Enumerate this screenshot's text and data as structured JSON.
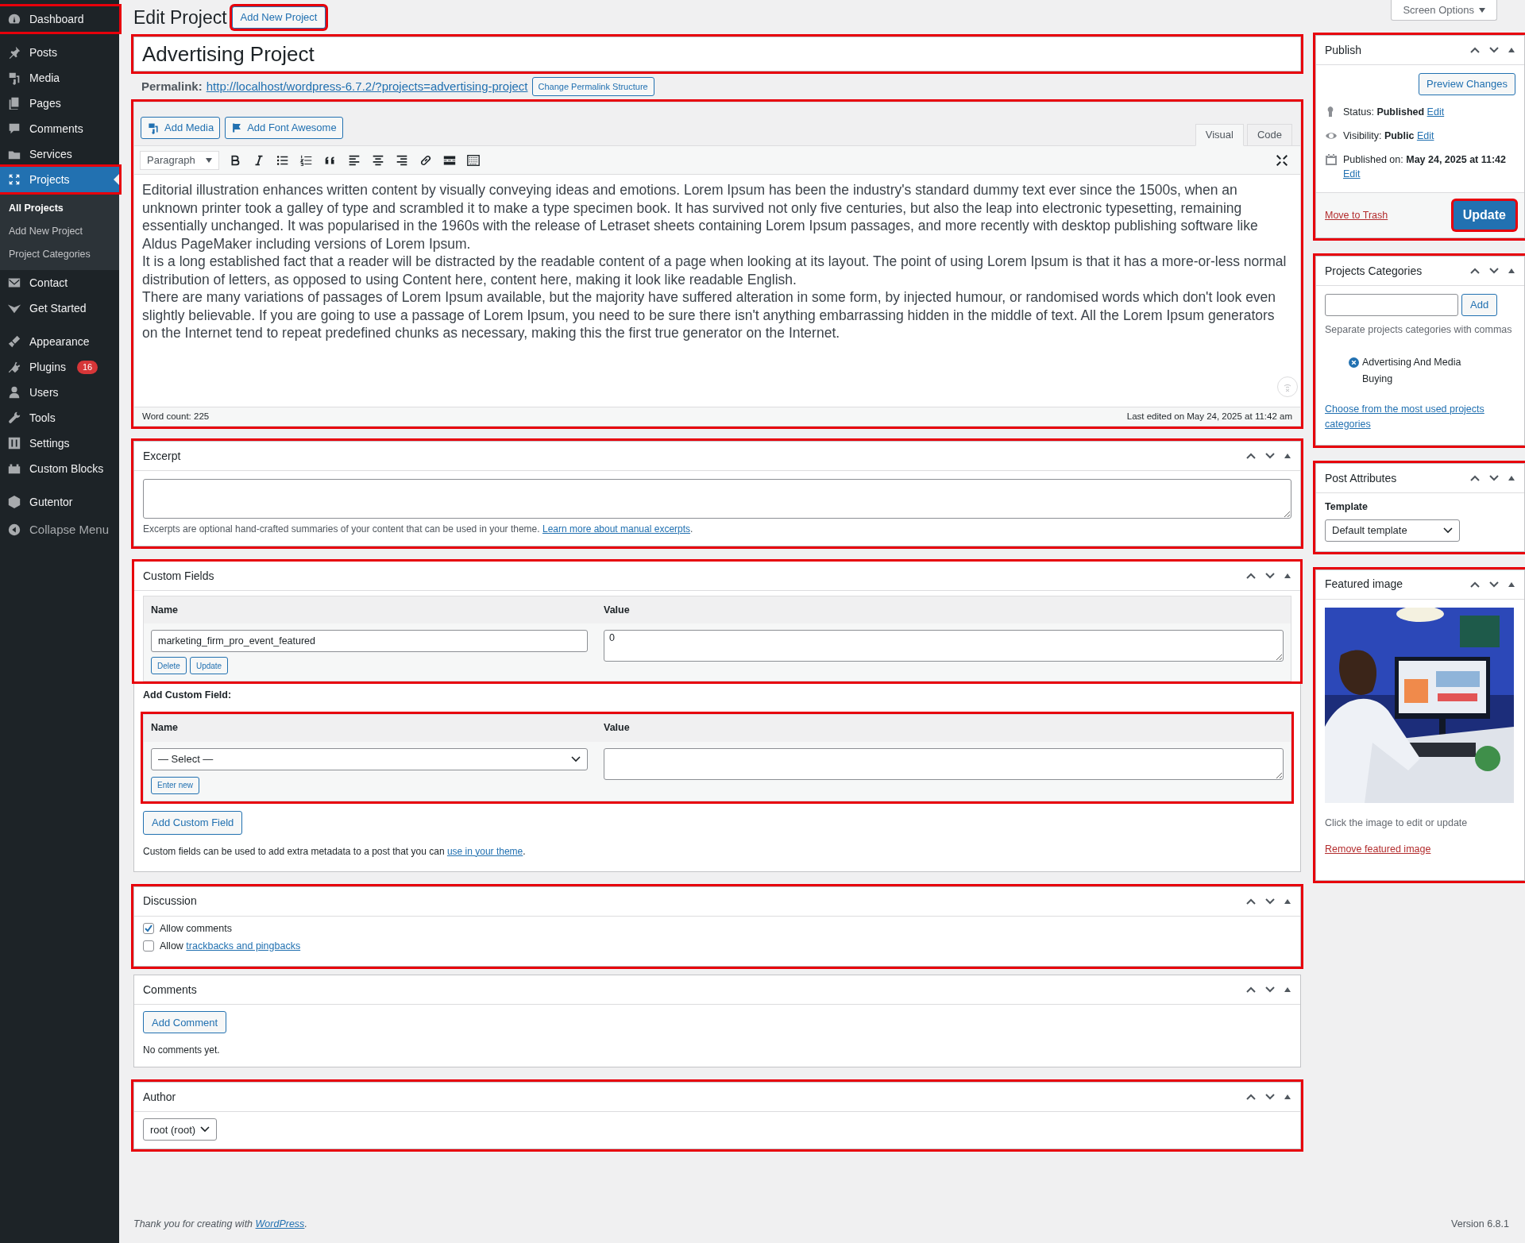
{
  "sidebar": {
    "items": [
      {
        "label": "Dashboard",
        "selected": false,
        "highlighted": true
      },
      {
        "label": "Posts",
        "selected": false,
        "highlighted": false
      },
      {
        "label": "Media",
        "selected": false,
        "highlighted": false
      },
      {
        "label": "Pages",
        "selected": false,
        "highlighted": false
      },
      {
        "label": "Comments",
        "selected": false,
        "highlighted": false
      },
      {
        "label": "Services",
        "selected": false,
        "highlighted": false
      },
      {
        "label": "Projects",
        "selected": true,
        "highlighted": true,
        "children": [
          {
            "label": "All Projects",
            "selected": true
          },
          {
            "label": "Add New Project",
            "selected": false
          },
          {
            "label": "Project Categories",
            "selected": false
          }
        ]
      },
      {
        "label": "Contact",
        "selected": false,
        "highlighted": false
      },
      {
        "label": "Get Started",
        "selected": false,
        "highlighted": false
      },
      {
        "label": "Appearance",
        "selected": false,
        "highlighted": false
      },
      {
        "label": "Plugins",
        "selected": false,
        "highlighted": false,
        "badge": "16"
      },
      {
        "label": "Users",
        "selected": false,
        "highlighted": false
      },
      {
        "label": "Tools",
        "selected": false,
        "highlighted": false
      },
      {
        "label": "Settings",
        "selected": false,
        "highlighted": false
      },
      {
        "label": "Custom Blocks",
        "selected": false,
        "highlighted": false
      },
      {
        "label": "Gutentor",
        "selected": false,
        "highlighted": false
      }
    ],
    "collapse": "Collapse Menu"
  },
  "header": {
    "title": "Edit Project",
    "add_new": {
      "label": "Add New Project",
      "highlighted": true
    },
    "screen_options": "Screen Options"
  },
  "post_title": {
    "value": "Advertising Project",
    "highlighted": true
  },
  "permalink": {
    "label": "Permalink:",
    "url": "http://localhost/wordpress-6.7.2/?projects=advertising-project",
    "button": "Change Permalink Structure"
  },
  "editor": {
    "highlighted": true,
    "media_buttons": [
      "Add Media",
      "Add Font Awesome"
    ],
    "tabs": [
      {
        "label": "Visual",
        "selected": true
      },
      {
        "label": "Code",
        "selected": false
      }
    ],
    "format": "Paragraph",
    "paragraphs": [
      "Editorial illustration enhances written content by visually conveying ideas and emotions. Lorem Ipsum has been the industry's standard dummy text ever since the 1500s, when an unknown printer took a galley of type and scrambled it to make a type specimen book. It has survived not only five centuries, but also the leap into electronic typesetting, remaining essentially unchanged. It was popularised in the 1960s with the release of Letraset sheets containing Lorem Ipsum passages, and more recently with desktop publishing software like Aldus PageMaker including versions of Lorem Ipsum.",
      "It is a long established fact that a reader will be distracted by the readable content of a page when looking at its layout. The point of using Lorem Ipsum is that it has a more-or-less normal distribution of letters, as opposed to using Content here, content here, making it look like readable English.",
      "There are many variations of passages of Lorem Ipsum available, but the majority have suffered alteration in some form, by injected humour, or randomised words which don't look even slightly believable. If you are going to use a passage of Lorem Ipsum, you need to be sure there isn't anything embarrassing hidden in the middle of text. All the Lorem Ipsum generators on the Internet tend to repeat predefined chunks as necessary, making this the first true generator on the Internet."
    ],
    "word_count": "Word count: 225",
    "last_edited": "Last edited on May 24, 2025 at 11:42 am"
  },
  "excerpt": {
    "title": "Excerpt",
    "highlighted": true,
    "help": "Excerpts are optional hand-crafted summaries of your content that can be used in your theme.",
    "help_link": "Learn more about manual excerpts",
    "help_end": "."
  },
  "custom_fields": {
    "title": "Custom Fields",
    "highlighted": true,
    "columns": [
      "Name",
      "Value"
    ],
    "rows": [
      {
        "name": "marketing_firm_pro_event_featured",
        "value": "0",
        "buttons": [
          "Delete",
          "Update"
        ]
      }
    ],
    "add_label": "Add Custom Field:",
    "add": {
      "highlighted": true,
      "columns": [
        "Name",
        "Value"
      ],
      "select": "— Select —",
      "enter_new": "Enter new"
    },
    "add_button": "Add Custom Field",
    "help": "Custom fields can be used to add extra metadata to a post that you can",
    "help_link": "use in your theme",
    "help_end": "."
  },
  "discussion": {
    "title": "Discussion",
    "highlighted": true,
    "options": [
      {
        "label": "Allow comments",
        "checked": true
      },
      {
        "label": "Allow",
        "link": "trackbacks and pingbacks",
        "checked": false
      }
    ]
  },
  "comments": {
    "title": "Comments",
    "highlighted": false,
    "button": "Add Comment",
    "empty": "No comments yet."
  },
  "author": {
    "title": "Author",
    "highlighted": true,
    "select": "root (root)"
  },
  "publish": {
    "title": "Publish",
    "highlighted": true,
    "preview": "Preview Changes",
    "rows": [
      {
        "label": "Status:",
        "value": "Published",
        "link": "Edit"
      },
      {
        "label": "Visibility:",
        "value": "Public",
        "link": "Edit"
      },
      {
        "label": "Published on:",
        "value": "May 24, 2025 at 11:42",
        "link": "Edit"
      }
    ],
    "trash": "Move to Trash",
    "update": {
      "label": "Update",
      "highlighted": true
    }
  },
  "categories": {
    "title": "Projects Categories",
    "highlighted": true,
    "add": "Add",
    "help": "Separate projects categories with commas",
    "tags": [
      "Advertising And Media Buying"
    ],
    "choose": "Choose from the most used projects categories"
  },
  "attributes": {
    "title": "Post Attributes",
    "highlighted": true,
    "template_label": "Template",
    "template": "Default template"
  },
  "featured": {
    "title": "Featured image",
    "highlighted": true,
    "hint": "Click the image to edit or update",
    "remove": "Remove featured image"
  },
  "footer": {
    "text": "Thank you for creating with",
    "link": "WordPress",
    "end": ".",
    "version": "Version 6.8.1"
  }
}
